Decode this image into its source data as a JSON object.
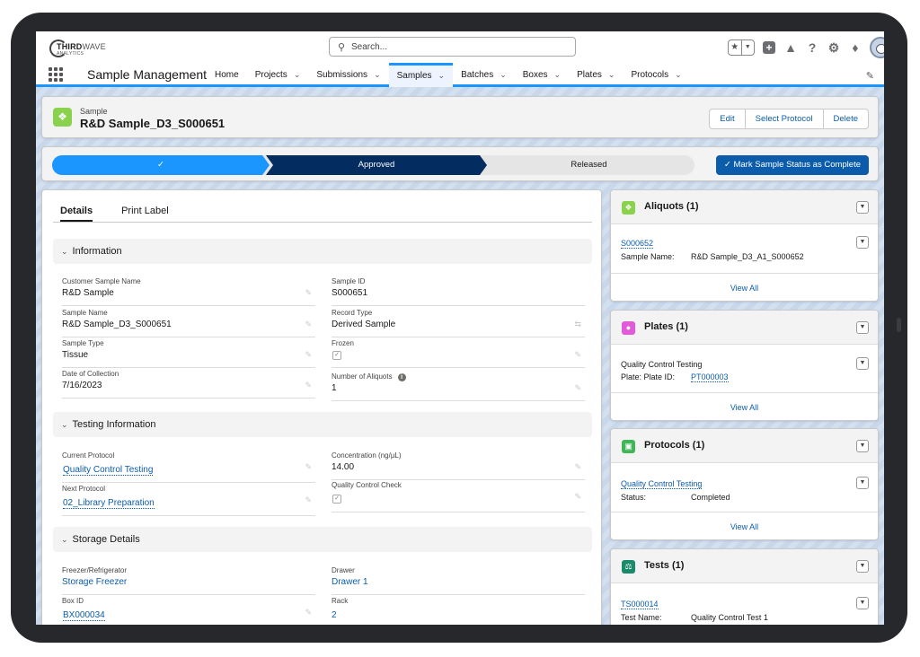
{
  "brand": {
    "logo_main": "THIRD",
    "logo_accent": "WAVE",
    "logo_sub": "ANALYTICS"
  },
  "search": {
    "placeholder": "Search..."
  },
  "app": {
    "name": "Sample Management"
  },
  "nav": {
    "items": [
      {
        "label": "Home",
        "dropdown": false
      },
      {
        "label": "Projects",
        "dropdown": true
      },
      {
        "label": "Submissions",
        "dropdown": true
      },
      {
        "label": "Samples",
        "dropdown": true,
        "active": true
      },
      {
        "label": "Batches",
        "dropdown": true
      },
      {
        "label": "Boxes",
        "dropdown": true
      },
      {
        "label": "Plates",
        "dropdown": true
      },
      {
        "label": "Protocols",
        "dropdown": true
      }
    ]
  },
  "record": {
    "object_label": "Sample",
    "title": "R&D Sample_D3_S000651",
    "actions": [
      "Edit",
      "Select Protocol",
      "Delete"
    ]
  },
  "path": {
    "completed_check": "✓",
    "current": "Approved",
    "next": "Released",
    "mark_button": "Mark Sample Status as Complete"
  },
  "tabs": [
    "Details",
    "Print Label"
  ],
  "sections": {
    "information": "Information",
    "testing": "Testing Information",
    "storage": "Storage Details"
  },
  "fields": {
    "customer_sample_name": {
      "label": "Customer Sample Name",
      "value": "R&D Sample"
    },
    "sample_id": {
      "label": "Sample ID",
      "value": "S000651"
    },
    "sample_name": {
      "label": "Sample Name",
      "value": "R&D Sample_D3_S000651"
    },
    "record_type": {
      "label": "Record Type",
      "value": "Derived Sample"
    },
    "sample_type": {
      "label": "Sample Type",
      "value": "Tissue"
    },
    "frozen": {
      "label": "Frozen",
      "checked": true
    },
    "date_of_collection": {
      "label": "Date of Collection",
      "value": "7/16/2023"
    },
    "number_of_aliquots": {
      "label": "Number of Aliquots",
      "value": "1"
    },
    "current_protocol": {
      "label": "Current Protocol",
      "value": "Quality Control Testing"
    },
    "concentration": {
      "label": "Concentration (ng/µL)",
      "value": "14.00"
    },
    "next_protocol": {
      "label": "Next Protocol",
      "value": "02_Library Preparation"
    },
    "qc_check": {
      "label": "Quality Control Check",
      "checked": true
    },
    "freezer": {
      "label": "Freezer/Refrigerator",
      "value": "Storage Freezer"
    },
    "drawer": {
      "label": "Drawer",
      "value": "Drawer 1"
    },
    "box_id": {
      "label": "Box ID",
      "value": "BX000034"
    },
    "rack": {
      "label": "Rack",
      "value": "2"
    }
  },
  "related": {
    "view_all": "View All",
    "aliquots": {
      "title": "Aliquots (1)",
      "link": "S000652",
      "field_label": "Sample Name:",
      "field_value": "R&D Sample_D3_A1_S000652",
      "icon_color": "#8ad24d"
    },
    "plates": {
      "title": "Plates (1)",
      "name": "Quality Control Testing",
      "field_label": "Plate: Plate ID:",
      "field_value": "PT000003",
      "icon_color": "#e25adb"
    },
    "protocols": {
      "title": "Protocols (1)",
      "link": "Quality Control Testing",
      "field_label": "Status:",
      "field_value": "Completed",
      "icon_color": "#41b658"
    },
    "tests": {
      "title": "Tests (1)",
      "link": "TS000014",
      "field_label": "Test Name:",
      "field_value": "Quality Control Test 1",
      "icon_color": "#1b8a6b"
    }
  },
  "colors": {
    "brand_blue": "#1b96ff",
    "path_dark": "#032d60",
    "button_blue": "#0b5cab"
  }
}
